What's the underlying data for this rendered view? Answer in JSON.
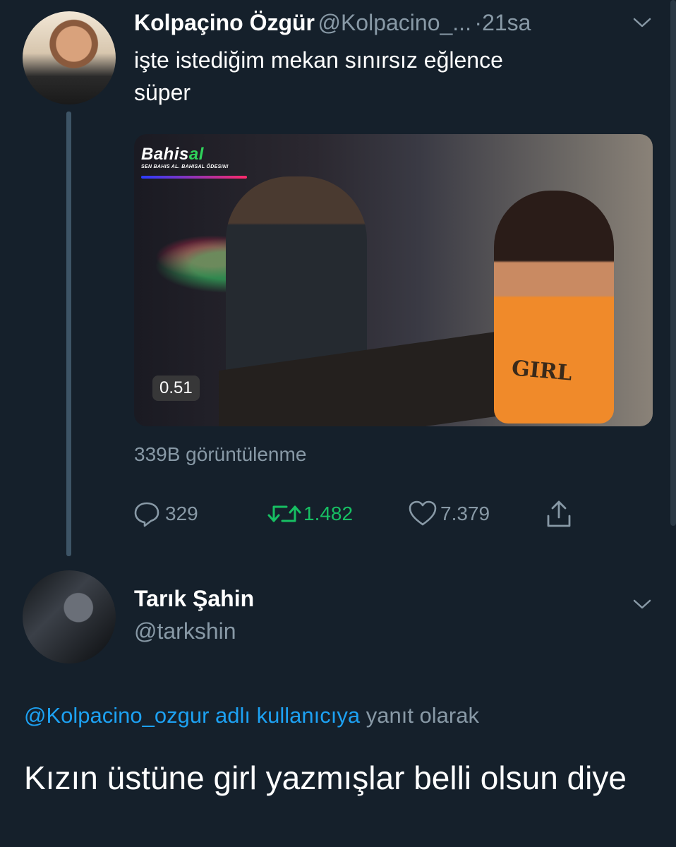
{
  "tweet": {
    "author_name": "Kolpaçino Özgür",
    "author_handle": "@Kolpacino_...",
    "separator": "·",
    "time": "21sa",
    "text_line1": "işte istediğim mekan sınırsız eğlence",
    "text_line2": "süper",
    "media": {
      "logo_text_main": "Bahis",
      "logo_text_accent": "al",
      "logo_tagline": "SEN BAHIS AL. BAHISAL ÖDESIN!",
      "shirt_text": "GIRL",
      "duration": "0.51"
    },
    "views": "339B görüntülenme",
    "reply_count": "329",
    "retweet_count": "1.482",
    "like_count": "7.379",
    "icons": {
      "reply": "reply-bubble-icon",
      "retweet": "retweet-icon",
      "like": "heart-icon",
      "share": "share-icon",
      "more": "chevron-down-icon"
    },
    "colors": {
      "retweet": "#17bf63",
      "link": "#1da1f2",
      "muted": "#8899a6",
      "background": "#15202b"
    }
  },
  "reply": {
    "author_name": "Tarık Şahin",
    "author_handle": "@tarkshin",
    "reply_to_link": "@Kolpacino_ozgur adlı kullanıcıya",
    "reply_to_suffix": "yanıt olarak",
    "text": "Kızın üstüne girl yazmışlar belli olsun diye"
  }
}
